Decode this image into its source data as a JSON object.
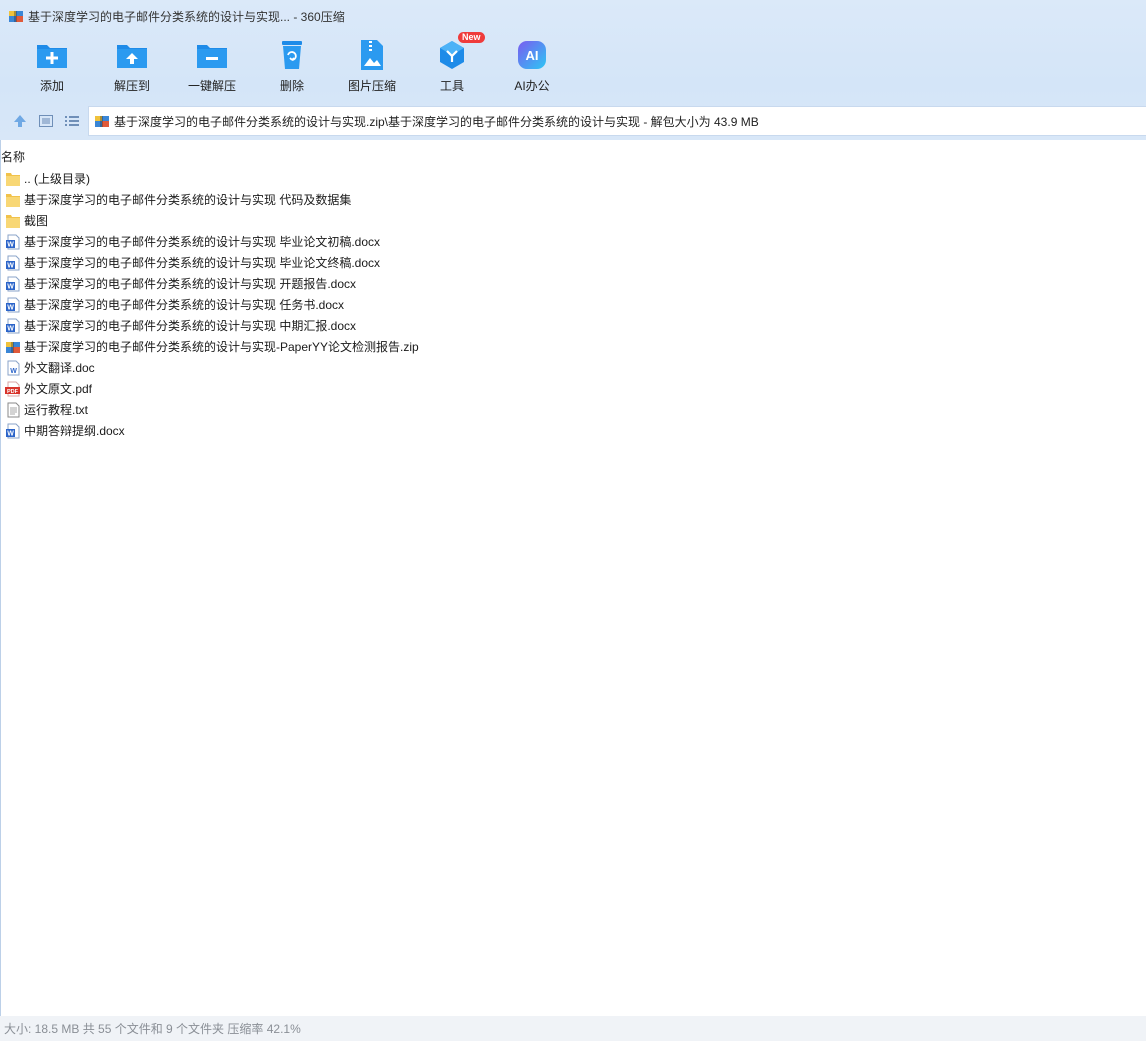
{
  "window": {
    "title": "基于深度学习的电子邮件分类系统的设计与实现... - 360压缩",
    "app_icon": "archive-icon"
  },
  "toolbar": {
    "buttons": [
      {
        "label": "添加",
        "icon": "add-icon"
      },
      {
        "label": "解压到",
        "icon": "extract-to-icon"
      },
      {
        "label": "一键解压",
        "icon": "one-click-extract-icon"
      },
      {
        "label": "删除",
        "icon": "delete-icon"
      },
      {
        "label": "图片压缩",
        "icon": "image-compress-icon"
      },
      {
        "label": "工具",
        "icon": "tools-icon",
        "badge": "New"
      },
      {
        "label": "AI办公",
        "icon": "ai-office-icon",
        "glyph": "AI"
      }
    ]
  },
  "nav": {
    "up_icon": "up-arrow-icon",
    "thumbnail_view_icon": "thumbnail-view-icon",
    "list_view_icon": "list-view-icon",
    "address": "基于深度学习的电子邮件分类系统的设计与实现.zip\\基于深度学习的电子邮件分类系统的设计与实现 - 解包大小为 43.9 MB"
  },
  "list": {
    "column_header": "名称",
    "items": [
      {
        "name": ".. (上级目录)",
        "type": "folder"
      },
      {
        "name": "基于深度学习的电子邮件分类系统的设计与实现 代码及数据集",
        "type": "folder"
      },
      {
        "name": "截图",
        "type": "folder"
      },
      {
        "name": "基于深度学习的电子邮件分类系统的设计与实现 毕业论文初稿.docx",
        "type": "word"
      },
      {
        "name": "基于深度学习的电子邮件分类系统的设计与实现 毕业论文终稿.docx",
        "type": "word"
      },
      {
        "name": "基于深度学习的电子邮件分类系统的设计与实现 开题报告.docx",
        "type": "word"
      },
      {
        "name": "基于深度学习的电子邮件分类系统的设计与实现 任务书.docx",
        "type": "word"
      },
      {
        "name": "基于深度学习的电子邮件分类系统的设计与实现 中期汇报.docx",
        "type": "word"
      },
      {
        "name": "基于深度学习的电子邮件分类系统的设计与实现-PaperYY论文检测报告.zip",
        "type": "zip"
      },
      {
        "name": "外文翻译.doc",
        "type": "doc"
      },
      {
        "name": "外文原文.pdf",
        "type": "pdf",
        "glyph": "PDF"
      },
      {
        "name": "运行教程.txt",
        "type": "txt"
      },
      {
        "name": "中期答辩提纲.docx",
        "type": "word"
      }
    ],
    "word_glyph": "W"
  },
  "status": {
    "text": "大小: 18.5 MB 共 55 个文件和 9 个文件夹 压缩率 42.1%"
  },
  "colors": {
    "accent_blue": "#1e8be8",
    "folder_yellow": "#f8d775",
    "word_blue": "#2b64c9",
    "pdf_red": "#d8342b",
    "ai_gradient_start": "#7a5cf0",
    "ai_gradient_end": "#2cc6f4",
    "badge_red": "#ef3b3b"
  }
}
